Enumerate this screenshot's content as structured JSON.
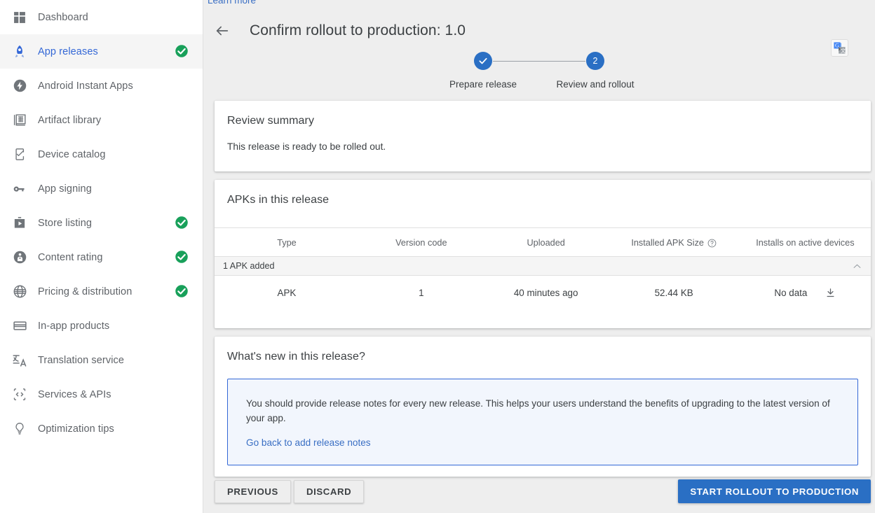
{
  "sidebar": {
    "items": [
      {
        "label": "Dashboard",
        "icon": "dashboard-icon",
        "active": false,
        "check": false
      },
      {
        "label": "App releases",
        "icon": "rocket-icon",
        "active": true,
        "check": true
      },
      {
        "label": "Android Instant Apps",
        "icon": "bolt-icon",
        "active": false,
        "check": false
      },
      {
        "label": "Artifact library",
        "icon": "library-icon",
        "active": false,
        "check": false
      },
      {
        "label": "Device catalog",
        "icon": "device-check-icon",
        "active": false,
        "check": false
      },
      {
        "label": "App signing",
        "icon": "key-icon",
        "active": false,
        "check": false
      },
      {
        "label": "Store listing",
        "icon": "store-icon",
        "active": false,
        "check": true
      },
      {
        "label": "Content rating",
        "icon": "person-badge-icon",
        "active": false,
        "check": true
      },
      {
        "label": "Pricing & distribution",
        "icon": "globe-icon",
        "active": false,
        "check": true
      },
      {
        "label": "In-app products",
        "icon": "card-icon",
        "active": false,
        "check": false
      },
      {
        "label": "Translation service",
        "icon": "translate-icon",
        "active": false,
        "check": false
      },
      {
        "label": "Services & APIs",
        "icon": "code-icon",
        "active": false,
        "check": false
      },
      {
        "label": "Optimization tips",
        "icon": "bulb-icon",
        "active": false,
        "check": false
      }
    ]
  },
  "header": {
    "learn_more": "Learn more",
    "back_icon": "back-arrow-icon",
    "title": "Confirm rollout to production: 1.0",
    "translate_badge_icon": "google-translate-icon"
  },
  "stepper": {
    "steps": [
      {
        "bullet": "✓",
        "label": "Prepare release",
        "state": "complete"
      },
      {
        "bullet": "2",
        "label": "Review and rollout",
        "state": "current"
      }
    ]
  },
  "review_summary": {
    "title": "Review summary",
    "body": "This release is ready to be rolled out."
  },
  "apks": {
    "title": "APKs in this release",
    "columns": [
      "Type",
      "Version code",
      "Uploaded",
      "Installed APK Size",
      "Installs on active devices"
    ],
    "size_help_icon": "help-circle-icon",
    "group_label": "1 APK added",
    "group_collapse_icon": "chevron-up-icon",
    "rows": [
      {
        "type": "APK",
        "version_code": "1",
        "uploaded": "40 minutes ago",
        "size": "52.44 KB",
        "installs": "No data",
        "download_icon": "download-icon"
      }
    ]
  },
  "whats_new": {
    "title": "What's new in this release?",
    "notice": "You should provide release notes for every new release. This helps your users understand the benefits of upgrading to the latest version of your app.",
    "link": "Go back to add release notes"
  },
  "footer": {
    "previous": "PREVIOUS",
    "discard": "DISCARD",
    "start_rollout": "START ROLLOUT TO PRODUCTION"
  },
  "colors": {
    "accent_blue": "#2a6fc4",
    "link_blue": "#3a6fc4",
    "notice_border": "#3367d6",
    "notice_bg": "#f2f6fd",
    "check_green": "#18a05a",
    "page_bg": "#eeeeee"
  }
}
